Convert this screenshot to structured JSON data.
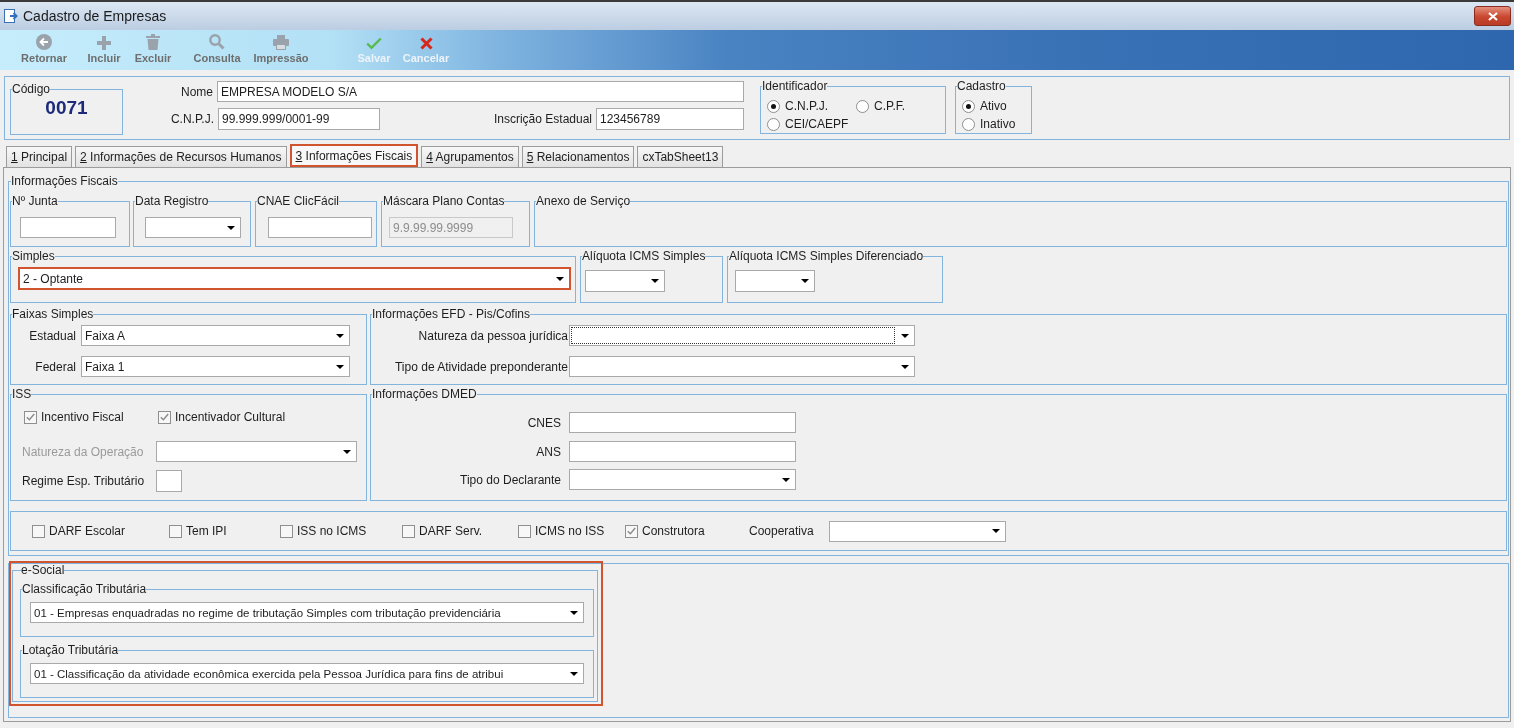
{
  "window": {
    "title": "Cadastro de Empresas"
  },
  "toolbar": [
    {
      "kind": "back",
      "label": "Retornar",
      "disabled": true
    },
    {
      "kind": "add",
      "label": "Incluir",
      "disabled": true
    },
    {
      "kind": "delete",
      "label": "Excluir",
      "disabled": true
    },
    {
      "kind": "search",
      "label": "Consulta",
      "disabled": true
    },
    {
      "kind": "print",
      "label": "Impressão",
      "disabled": true
    },
    {
      "kind": "save",
      "label": "Salvar",
      "disabled": false
    },
    {
      "kind": "cancel",
      "label": "Cancelar",
      "disabled": false
    }
  ],
  "header": {
    "code": {
      "title": "Código",
      "value": "0071"
    },
    "name": {
      "label": "Nome",
      "value": "EMPRESA MODELO S/A"
    },
    "cnpj": {
      "label": "C.N.P.J.",
      "value": "99.999.999/0001-99"
    },
    "state_registration": {
      "label": "Inscrição Estadual",
      "value": "123456789"
    },
    "identifier": {
      "title": "Identificador",
      "options": [
        {
          "label": "C.N.P.J.",
          "selected": true
        },
        {
          "label": "C.P.F.",
          "selected": false
        },
        {
          "label": "CEI/CAEPF",
          "selected": false
        }
      ]
    },
    "status": {
      "title": "Cadastro",
      "options": [
        {
          "label": "Ativo",
          "selected": true
        },
        {
          "label": "Inativo",
          "selected": false
        }
      ]
    }
  },
  "tabs": [
    {
      "key": "1",
      "label": "Principal",
      "selected": false,
      "highlighted": false
    },
    {
      "key": "2",
      "label": "Informações de Recursos Humanos",
      "selected": false,
      "highlighted": false
    },
    {
      "key": "3",
      "label": "Informações Fiscais",
      "selected": true,
      "highlighted": true
    },
    {
      "key": "4",
      "label": "Agrupamentos",
      "selected": false,
      "highlighted": false
    },
    {
      "key": "5",
      "label": "Relacionamentos",
      "selected": false,
      "highlighted": false
    },
    {
      "label": "cxTabSheet13",
      "selected": false,
      "highlighted": false
    }
  ],
  "fiscal_info": {
    "title": "Informações Fiscais",
    "registration": [
      {
        "kind": "input",
        "title": "Nº Junta",
        "disabled": false
      },
      {
        "kind": "combo",
        "title": "Data Registro",
        "disabled": false
      },
      {
        "kind": "input",
        "title": "CNAE ClicFácil",
        "disabled": false
      },
      {
        "kind": "input",
        "title": "Máscara Plano Contas",
        "value": "9.9.99.99.9999",
        "disabled": true
      },
      {
        "kind": "none",
        "title": "Anexo de Serviço"
      }
    ],
    "simples": {
      "title": "Simples",
      "value": "2 - Optante",
      "highlighted": true
    },
    "icms_rates": [
      {
        "title": "Alíquota ICMS Simples"
      },
      {
        "title": "Alíquota ICMS Simples Diferenciado"
      }
    ],
    "simples_bands": {
      "title": "Faixas Simples",
      "fields": [
        {
          "label": "Estadual",
          "value": "Faixa A"
        },
        {
          "label": "Federal",
          "value": "Faixa 1"
        }
      ]
    },
    "efd": {
      "title": "Informações EFD - Pis/Cofins",
      "fields": [
        {
          "label": "Natureza da pessoa jurídica",
          "focused": true
        },
        {
          "label": "Tipo de Atividade preponderante",
          "focused": false
        }
      ]
    },
    "iss": {
      "title": "ISS",
      "checkboxes": [
        {
          "label": "Incentivo Fiscal",
          "checked": true
        },
        {
          "label": "Incentivador Cultural",
          "checked": true
        }
      ],
      "fields": [
        {
          "kind": "combo",
          "label": "Natureza da Operação",
          "disabled": true
        },
        {
          "kind": "input",
          "label": "Regime Esp. Tributário",
          "disabled": false
        }
      ]
    },
    "dmed": {
      "title": "Informações DMED",
      "fields": [
        {
          "kind": "input",
          "label": "CNES"
        },
        {
          "kind": "input",
          "label": "ANS"
        },
        {
          "kind": "combo",
          "label": "Tipo do Declarante"
        }
      ]
    },
    "flags": [
      {
        "label": "DARF Escolar",
        "checked": false
      },
      {
        "label": "Tem IPI",
        "checked": false
      },
      {
        "label": "ISS no ICMS",
        "checked": false
      },
      {
        "label": "DARF Serv.",
        "checked": false
      },
      {
        "label": "ICMS no ISS",
        "checked": false
      },
      {
        "label": "Construtora",
        "checked": true
      }
    ],
    "cooperative": {
      "label": "Cooperativa"
    }
  },
  "esocial": {
    "title": "e-Social",
    "highlighted": true,
    "fields": [
      {
        "title": "Classificação Tributária",
        "value": "01 - Empresas enquadradas no regime de tributação Simples com tributação previdenciária"
      },
      {
        "title": "Lotação Tributária",
        "value": "01 - Classificação da atividade econômica exercida pela Pessoa Jurídica para fins de atribui"
      }
    ]
  }
}
